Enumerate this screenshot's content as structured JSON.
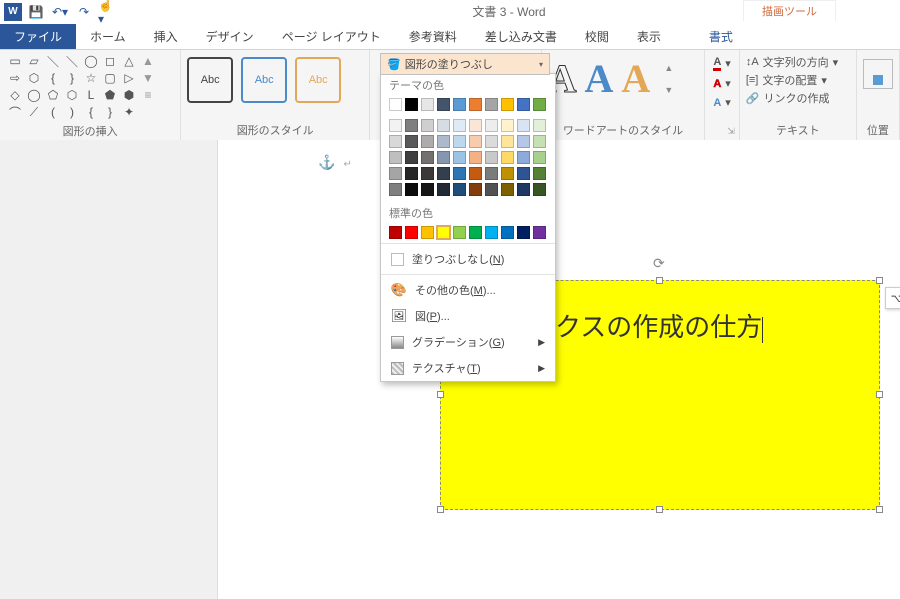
{
  "title": "文書 3 - Word",
  "contextual_tab": "描画ツール",
  "qat": {
    "word_icon": "W",
    "save": "💾",
    "undo": "↶",
    "redo": "↷",
    "touch": "☝"
  },
  "tabs": [
    "ファイル",
    "ホーム",
    "挿入",
    "デザイン",
    "ページ レイアウト",
    "参考資料",
    "差し込み文書",
    "校閲",
    "表示",
    "書式"
  ],
  "ribbon": {
    "group1_label": "図形の挿入",
    "abc": "Abc",
    "group2_label": "図形のスタイル",
    "fill_label": "図形の塗りつぶし",
    "group3_label": "ワードアートのスタイル",
    "text_dir": "文字列の方向",
    "align_text": "文字の配置",
    "create_link": "リンクの作成",
    "group4_label": "テキスト",
    "pos_label": "位置"
  },
  "dropdown": {
    "theme_label": "テーマの色",
    "std_label": "標準の色",
    "no_fill": "塗りつぶしなし",
    "no_fill_key": "N",
    "more": "その他の色",
    "more_key": "M",
    "picture": "図",
    "picture_key": "P",
    "gradient": "グラデーション",
    "gradient_key": "G",
    "texture": "テクスチャ",
    "texture_key": "T",
    "theme_top": [
      "#ffffff",
      "#000000",
      "#e7e6e6",
      "#44546a",
      "#5b9bd5",
      "#ed7d31",
      "#a5a5a5",
      "#ffc000",
      "#4472c4",
      "#70ad47"
    ],
    "theme_shades": [
      [
        "#f2f2f2",
        "#7f7f7f",
        "#d0cece",
        "#d6dce4",
        "#deebf6",
        "#fbe5d5",
        "#ededed",
        "#fff2cc",
        "#dae3f3",
        "#e2efd9"
      ],
      [
        "#d8d8d8",
        "#595959",
        "#aeabab",
        "#adb9ca",
        "#bdd7ee",
        "#f7cbac",
        "#dbdbdb",
        "#fee599",
        "#b4c7e7",
        "#c5e0b3"
      ],
      [
        "#bfbfbf",
        "#3f3f3f",
        "#757070",
        "#8496b0",
        "#9cc3e5",
        "#f4b183",
        "#c9c9c9",
        "#ffd965",
        "#8eaadb",
        "#a8d08d"
      ],
      [
        "#a5a5a5",
        "#262626",
        "#3a3838",
        "#333f4f",
        "#2e75b5",
        "#c55a11",
        "#7b7b7b",
        "#bf9000",
        "#2f5496",
        "#538135"
      ],
      [
        "#7f7f7f",
        "#0c0c0c",
        "#171616",
        "#222a35",
        "#1e4e79",
        "#833c0b",
        "#525252",
        "#7f6000",
        "#1f3864",
        "#375623"
      ]
    ],
    "standard": [
      "#c00000",
      "#ff0000",
      "#ffc000",
      "#ffff00",
      "#92d050",
      "#00b050",
      "#00b0f0",
      "#0070c0",
      "#002060",
      "#7030a0"
    ]
  },
  "textbox_text": "ストボックスの作成の仕方"
}
